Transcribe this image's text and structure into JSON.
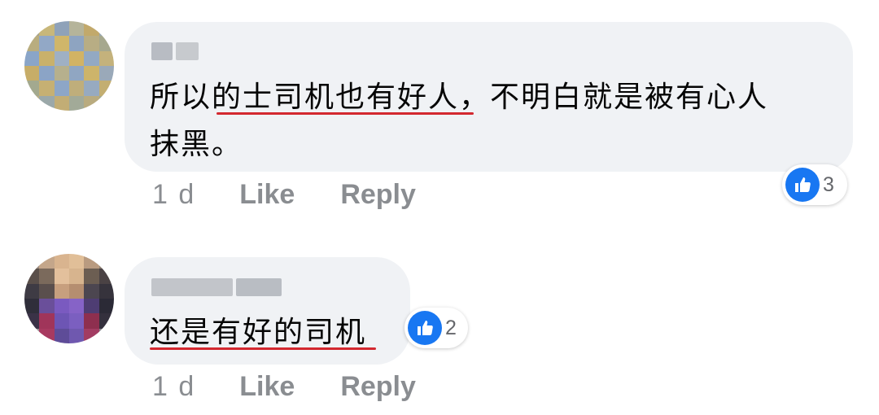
{
  "comments": [
    {
      "author": "",
      "text": "所以的士司机也有好人，不明白就是被有心人\n抹黑。",
      "time": "1 d",
      "like_label": "Like",
      "reply_label": "Reply",
      "reaction_count": "3",
      "reaction_icon": "thumbs-up-icon"
    },
    {
      "author": "",
      "text": "还是有好的司机",
      "time": "1 d",
      "like_label": "Like",
      "reply_label": "Reply",
      "reaction_count": "2",
      "reaction_icon": "thumbs-up-icon"
    }
  ],
  "colors": {
    "bubble": "#f0f2f5",
    "underline": "#d3282f",
    "reaction": "#1877f2",
    "meta": "#8a8d91"
  }
}
